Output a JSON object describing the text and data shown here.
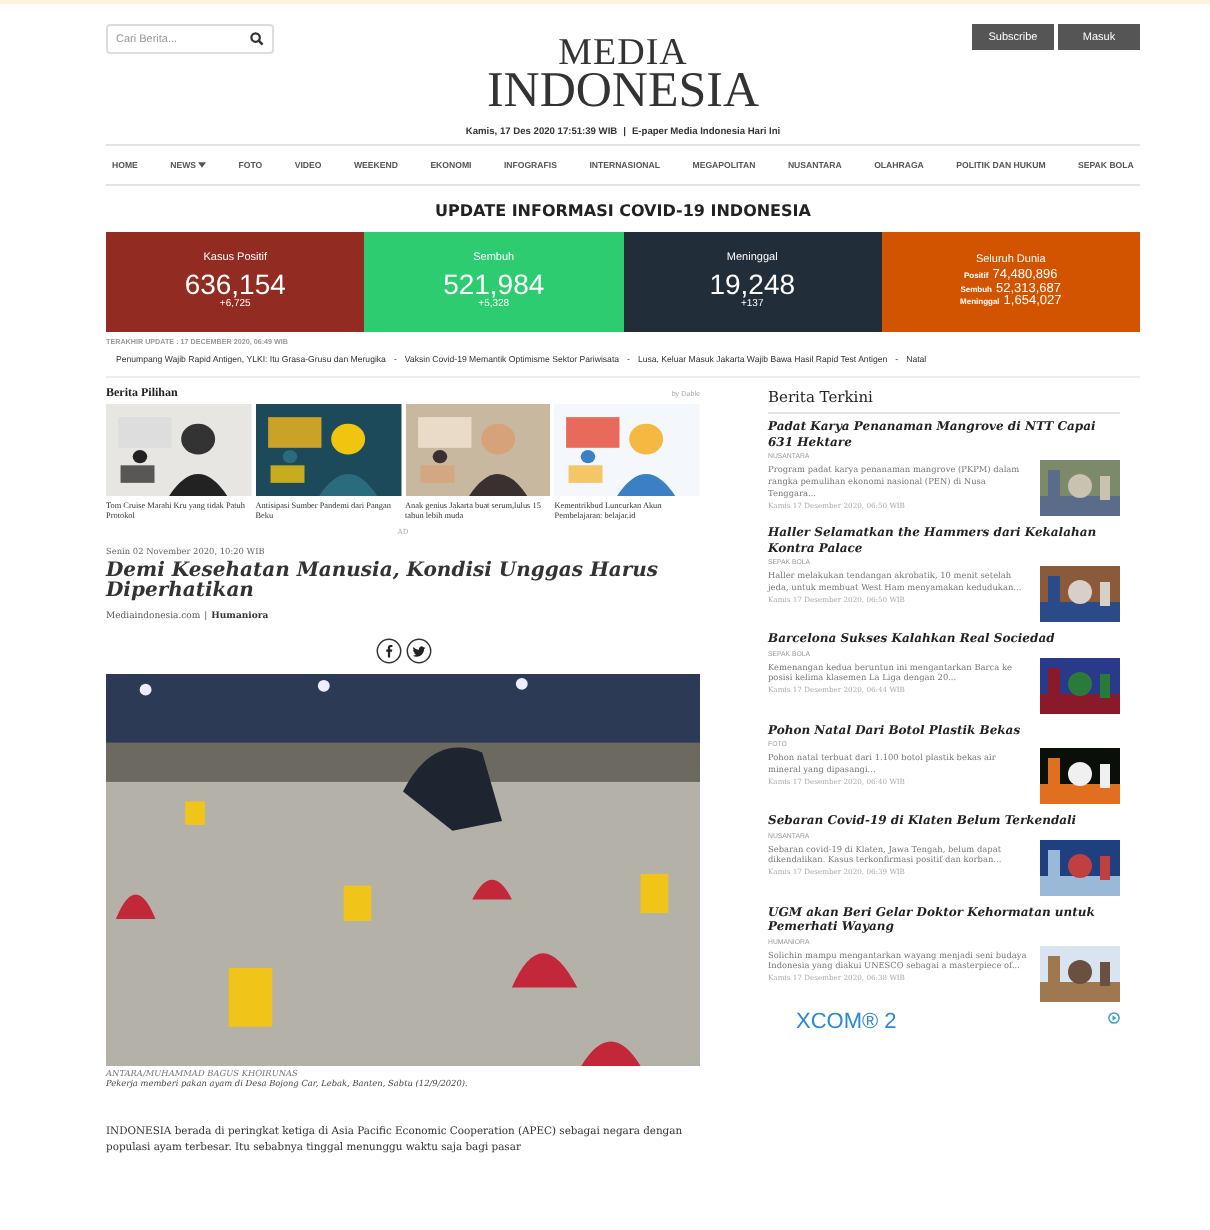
{
  "header": {
    "search": {
      "placeholder": "Cari Berita..."
    },
    "logo": {
      "line_1": "MEDIA",
      "line_2": "INDONESIA"
    },
    "buttons": [
      "Subscribe",
      "Masuk"
    ],
    "date": "Kamis, 17 Des 2020 17:51:39 WIB",
    "separator": "|",
    "epaper_link": "E-paper Media Indonesia Hari Ini"
  },
  "nav": [
    {
      "label": "HOME",
      "dropdown": false
    },
    {
      "label": "NEWS",
      "dropdown": true
    },
    {
      "label": "FOTO",
      "dropdown": false
    },
    {
      "label": "VIDEO",
      "dropdown": false
    },
    {
      "label": "WEEKEND",
      "dropdown": false
    },
    {
      "label": "EKONOMI",
      "dropdown": false
    },
    {
      "label": "INFOGRAFIS",
      "dropdown": false
    },
    {
      "label": "INTERNASIONAL",
      "dropdown": false
    },
    {
      "label": "MEGAPOLITAN",
      "dropdown": false
    },
    {
      "label": "NUSANTARA",
      "dropdown": false
    },
    {
      "label": "OLAHRAGA",
      "dropdown": false
    },
    {
      "label": "POLITIK DAN HUKUM",
      "dropdown": false
    },
    {
      "label": "SEPAK BOLA",
      "dropdown": false
    }
  ],
  "covid": {
    "title": "UPDATE INFORMASI COVID-19 INDONESIA",
    "tiles": [
      {
        "kind": "national",
        "label": "Kasus Positif",
        "value": "636,154",
        "delta": "+6,725",
        "color": "#922b21"
      },
      {
        "kind": "national",
        "label": "Sembuh",
        "value": "521,984",
        "delta": "+5,328",
        "color": "#2ecc71"
      },
      {
        "kind": "national",
        "label": "Meninggal",
        "value": "19,248",
        "delta": "+137",
        "color": "#222d3a"
      },
      {
        "kind": "world",
        "label": "Seluruh Dunia",
        "color": "#d35400",
        "rows": [
          {
            "label": "Positif",
            "value": "74,480,896"
          },
          {
            "label": "Sembuh",
            "value": "52,313,687"
          },
          {
            "label": "Meninggal",
            "value": "1,654,027"
          }
        ]
      }
    ],
    "last_update": "TERAKHIR UPDATE : 17 DECEMBER 2020, 06:49 WIB"
  },
  "ticker": {
    "items": [
      "Penumpang Wajib Rapid Antigen, YLKI: Itu Grasa-Grusu dan Merugika",
      "Vaksin Covid-19 Memantik Optimisme Sektor Pariwisata",
      "Lusa, Keluar Masuk Jakarta Wajib Bawa Hasil Rapid Test Antigen",
      "Natal"
    ],
    "separator": "-"
  },
  "berita_pilihan": {
    "title": "Berita Pilihan",
    "provider": "by Dable",
    "cards": [
      {
        "caption": "Tom Cruise Marahi Kru yang tidak Patuh Protokol"
      },
      {
        "caption": "Antisipasi Sumber Pandemi dari Pangan Beku"
      },
      {
        "caption": "Anak genius Jakarta buat serum,lulus 15 tahun lebih muda"
      },
      {
        "caption": "Kementrikbud Luncurkan Akun Pembelajaran: belajar.id"
      }
    ],
    "ad_label": "AD"
  },
  "article": {
    "date": "Senin 02 November 2020, 10:20 WIB",
    "title": "Demi Kesehatan Manusia, Kondisi Unggas Harus Diperhatikan",
    "source": "Mediaindonesia.com",
    "source_separator": "|",
    "category": "Humaniora",
    "photo_credit": "ANTARA/MUHAMMAD BAGUS KHOIRUNAS",
    "photo_caption": "Pekerja memberi pakan ayam di Desa Bojong Car, Lebak, Banten, Sabtu (12/9/2020).",
    "body": "INDONESIA berada di peringkat ketiga di Asia Pacific Economic Cooperation (APEC) sebagai negara dengan populasi ayam terbesar. Itu sebabnya  tinggal menunggu waktu saja bagi pasar"
  },
  "berita_terkini": {
    "title": "Berita Terkini",
    "items": [
      {
        "title": "Padat Karya Penanaman Mangrove di NTT Capai 631 Hektare",
        "category": "NUSANTARA",
        "summary": "Program padat karya penanaman mangrove (PKPM) dalam rangka pemulihan ekonomi nasional (PEN) di Nusa Tenggara...",
        "time": "Kamis 17 Desember 2020, 06:50 WIB"
      },
      {
        "title": "Haller Selamatkan the Hammers dari Kekalahan Kontra Palace",
        "category": "SEPAK BOLA",
        "summary": "Haller melakukan tendangan akrobatik, 10 menit setelah jeda, untuk membuat West Ham menyamakan kedudukan...",
        "time": "Kamis 17 Desember 2020, 06:50 WIB"
      },
      {
        "title": "Barcelona Sukses Kalahkan Real Sociedad",
        "category": "SEPAK BOLA",
        "summary": "Kemenangan kedua beruntun ini mengantarkan Barca ke posisi kelima klasemen La Liga dengan 20...",
        "time": "Kamis 17 Desember 2020, 06:44 WIB"
      },
      {
        "title": "Pohon Natal Dari Botol Plastik Bekas",
        "category": "FOTO",
        "summary": "Pohon natal  terbuat dari 1.100 botol plastik bekas air mineral yang dipasangi...",
        "time": "Kamis 17 Desember 2020, 06:40 WIB"
      },
      {
        "title": "Sebaran Covid-19 di Klaten Belum Terkendali",
        "category": "NUSANTARA",
        "summary": "Sebaran covid-19 di Klaten, Jawa Tengah, belum dapat dikendalikan. Kasus terkonfirmasi positif dan korban...",
        "time": "Kamis 17 Desember 2020, 06:39 WIB"
      },
      {
        "title": "UGM akan Beri Gelar Doktor Kehormatan untuk Pemerhati Wayang",
        "category": "HUMANIORA",
        "summary": "Solichin mampu mengantarkan wayang menjadi seni budaya Indonesia yang diakui UNESCO sebagai a masterpiece of...",
        "time": "Kamis 17 Desember 2020, 06:38 WIB"
      }
    ],
    "ad_text": "XCOM® 2"
  }
}
